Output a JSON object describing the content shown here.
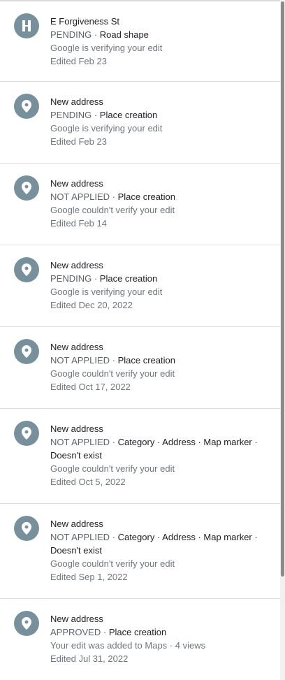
{
  "edits": [
    {
      "icon": "road-icon",
      "title": "E Forgiveness St",
      "status": "PENDING",
      "sep": " · ",
      "kind": "Road shape",
      "detail": "Google is verifying your edit",
      "date": "Edited Feb 23"
    },
    {
      "icon": "place-pin-icon",
      "title": "New address",
      "status": "PENDING",
      "sep": " · ",
      "kind": "Place creation",
      "detail": "Google is verifying your edit",
      "date": "Edited Feb 23"
    },
    {
      "icon": "place-pin-icon",
      "title": "New address",
      "status": "NOT APPLIED",
      "sep": " · ",
      "kind": "Place creation",
      "detail": "Google couldn't verify your edit",
      "date": "Edited Feb 14"
    },
    {
      "icon": "place-pin-icon",
      "title": "New address",
      "status": "PENDING",
      "sep": " · ",
      "kind": "Place creation",
      "detail": "Google is verifying your edit",
      "date": "Edited Dec 20, 2022"
    },
    {
      "icon": "place-pin-icon",
      "title": "New address",
      "status": "NOT APPLIED",
      "sep": " · ",
      "kind": "Place creation",
      "detail": "Google couldn't verify your edit",
      "date": "Edited Oct 17, 2022"
    },
    {
      "icon": "place-pin-icon",
      "title": "New address",
      "status": "NOT APPLIED",
      "sep": " · ",
      "kind": "Category · Address · Map marker · Doesn't exist",
      "detail": "Google couldn't verify your edit",
      "date": "Edited Oct 5, 2022"
    },
    {
      "icon": "place-pin-icon",
      "title": "New address",
      "status": "NOT APPLIED",
      "sep": " · ",
      "kind": "Category · Address · Map marker · Doesn't exist",
      "detail": "Google couldn't verify your edit",
      "date": "Edited Sep 1, 2022"
    },
    {
      "icon": "place-pin-icon",
      "title": "New address",
      "status": "APPROVED",
      "sep": " · ",
      "kind": "Place creation",
      "detail": "Your edit was added to Maps · 4 views",
      "date": "Edited Jul 31, 2022"
    }
  ]
}
